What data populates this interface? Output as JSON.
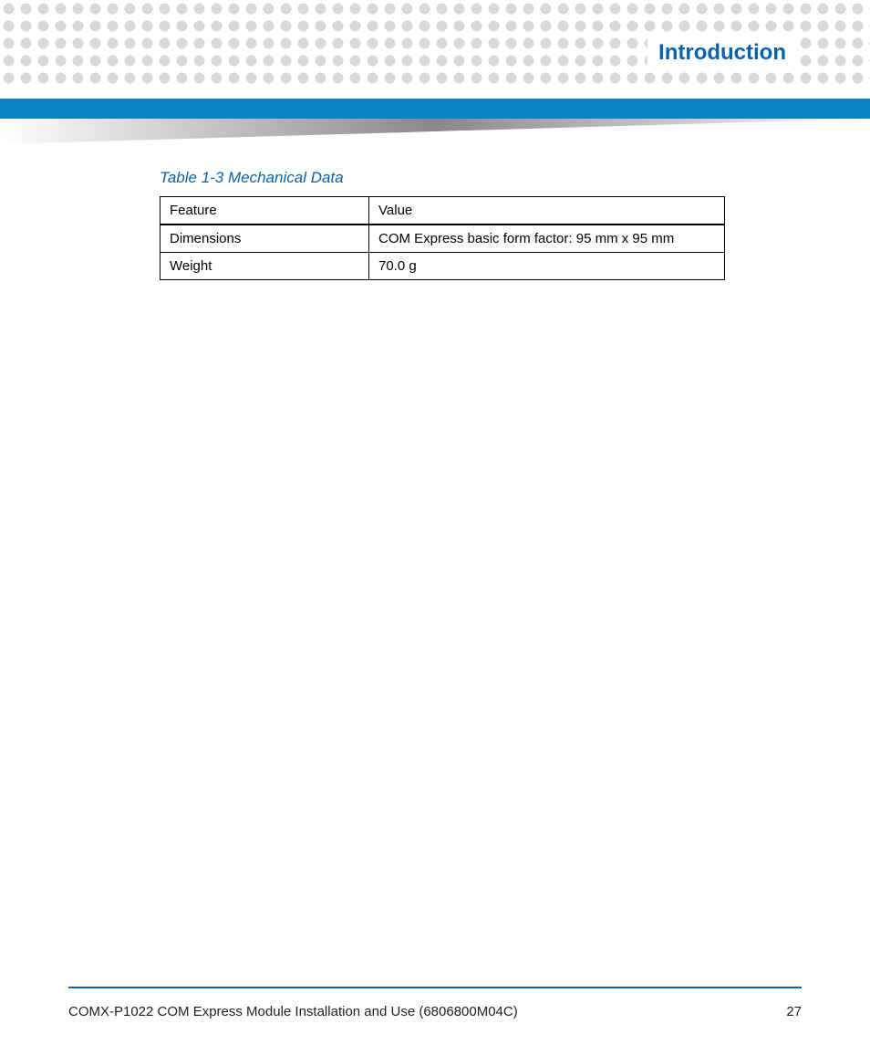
{
  "header": {
    "section_title": "Introduction"
  },
  "table": {
    "title": "Table 1-3 Mechanical Data",
    "headers": {
      "feature": "Feature",
      "value": "Value"
    },
    "rows": [
      {
        "feature": "Dimensions",
        "value": "COM Express basic form factor: 95  mm x 95 mm"
      },
      {
        "feature": "Weight",
        "value": "70.0 g"
      }
    ]
  },
  "footer": {
    "doc_title": "COMX-P1022 COM Express Module Installation and Use (6806800M04C)",
    "page_number": "27"
  }
}
